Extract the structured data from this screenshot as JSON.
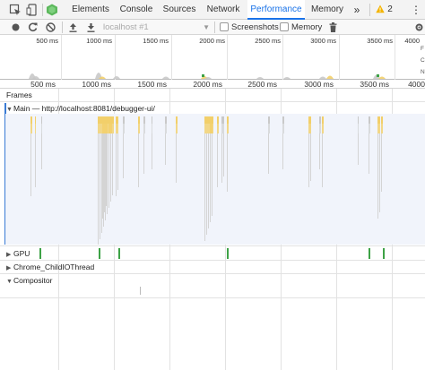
{
  "tabs": [
    {
      "label": "Elements",
      "active": false
    },
    {
      "label": "Console",
      "active": false
    },
    {
      "label": "Sources",
      "active": false
    },
    {
      "label": "Network",
      "active": false
    },
    {
      "label": "Performance",
      "active": true
    },
    {
      "label": "Memory",
      "active": false
    }
  ],
  "tabbar": {
    "more": "»",
    "warning_count": "2",
    "menu": "⋮"
  },
  "toolbar": {
    "target": "localhost #1",
    "screenshots_label": "Screenshots",
    "memory_label": "Memory"
  },
  "overview": {
    "ticks": [
      "500 ms",
      "1000 ms",
      "1500 ms",
      "2000 ms",
      "2500 ms",
      "3000 ms",
      "3500 ms",
      "4000"
    ],
    "right_labels": [
      "F",
      "C",
      "N"
    ]
  },
  "ruler": {
    "ticks": [
      "500 ms",
      "1000 ms",
      "1500 ms",
      "2000 ms",
      "2500 ms",
      "3000 ms",
      "3500 ms",
      "4000"
    ]
  },
  "tracks": {
    "frames": "Frames",
    "main": "Main — http://localhost:8081/debugger-ui/",
    "gpu": "GPU",
    "io_thread": "Chrome_ChildIOThread",
    "compositor": "Compositor"
  },
  "colors": {
    "accent": "#1a73e8",
    "scripting": "#f2cf6a",
    "idle": "#c9c9c9",
    "gpu": "#3da246",
    "main_bg": "#f1f4fb"
  }
}
